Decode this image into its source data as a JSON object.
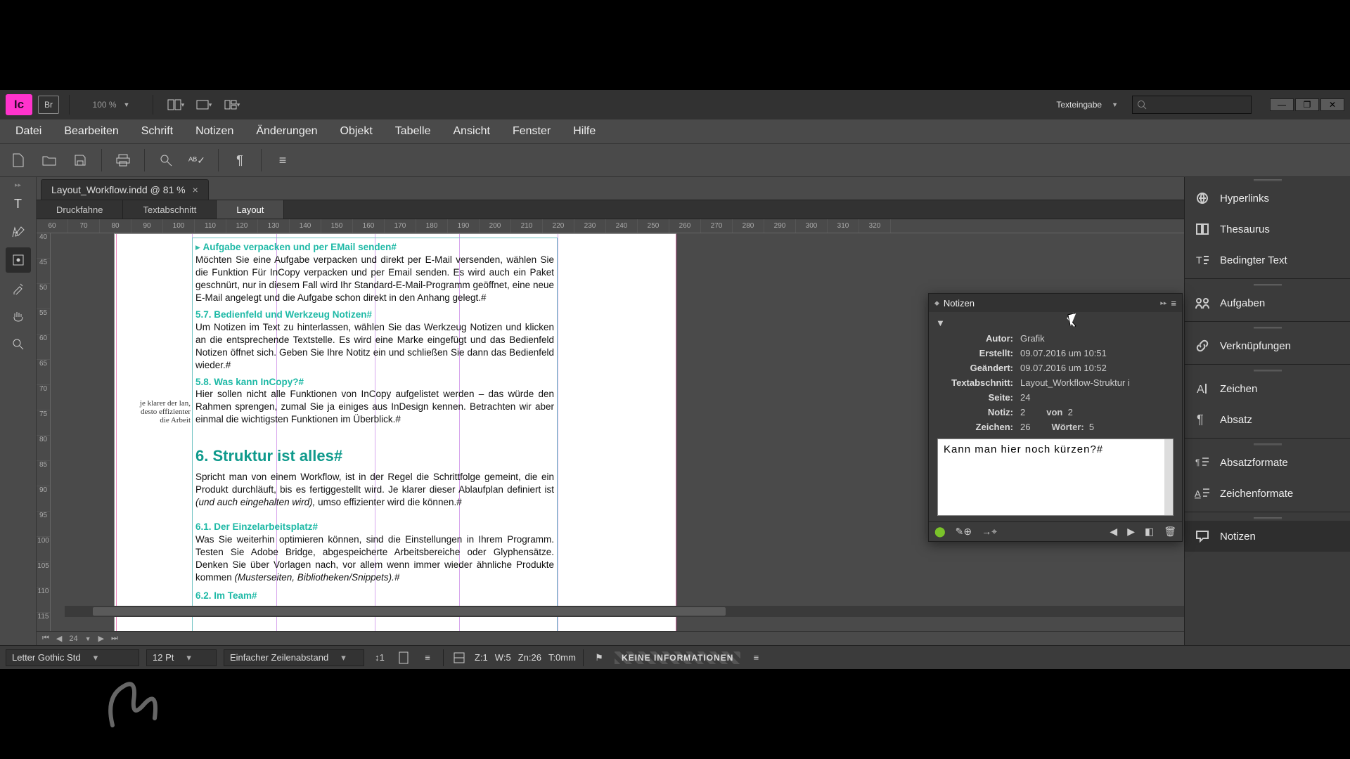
{
  "titlebar": {
    "zoom": "100 %",
    "workspace": "Texteingabe"
  },
  "menubar": [
    "Datei",
    "Bearbeiten",
    "Schrift",
    "Notizen",
    "Änderungen",
    "Objekt",
    "Tabelle",
    "Ansicht",
    "Fenster",
    "Hilfe"
  ],
  "doc": {
    "tab": "Layout_Workflow.indd @ 81 %",
    "views": [
      "Druckfahne",
      "Textabschnitt",
      "Layout"
    ],
    "active_view": 2,
    "page_nav": "24"
  },
  "ruler_h": [
    "60",
    "70",
    "80",
    "90",
    "100",
    "110",
    "120",
    "130",
    "140",
    "150",
    "160",
    "170",
    "180",
    "190",
    "200",
    "210",
    "220",
    "230",
    "240",
    "250",
    "260",
    "270",
    "280",
    "290",
    "300",
    "310",
    "320"
  ],
  "ruler_v": [
    "40",
    "45",
    "50",
    "55",
    "60",
    "65",
    "70",
    "75",
    "80",
    "85",
    "90",
    "95",
    "100",
    "105",
    "110",
    "115"
  ],
  "margin_note": "je klarer der lan,\ndesto effizienter\ndie Arbeit",
  "content": {
    "h1": "Aufgabe verpacken und per EMail senden#",
    "p1": "Möchten Sie eine Aufgabe verpacken und direkt per E-Mail versenden, wählen Sie die Funktion Für InCopy verpacken und per Email senden. Es wird auch ein Paket geschnürt, nur in diesem Fall wird Ihr Standard-E-Mail-Programm geöffnet, eine neue E-Mail angelegt und die Aufgabe schon direkt in den Anhang gelegt.#",
    "h2": "5.7.  Bedienfeld und Werkzeug Notizen#",
    "p2": "Um Notizen im Text zu hinterlassen, wählen Sie das Werkzeug Notizen und klicken an die entsprechende Textstelle. Es wird eine Marke eingefügt und das Bedienfeld Notizen öffnet sich. Geben Sie Ihre Notitz ein und schließen Sie dann das Bedienfeld wieder.#",
    "h3": "5.8.  Was kann InCopy?#",
    "p3": "Hier sollen nicht alle Funktionen von InCopy aufgelistet werden – das würde den Rahmen sprengen, zumal Sie ja einiges aus InDesign kennen. Betrachten wir aber einmal die wichtigsten Funktionen im Überblick.#",
    "h4": "6.  Struktur ist alles#",
    "p4a": "Spricht man von einem Workflow, ist in der Regel die Schrittfolge gemeint, die ein Produkt durchläuft, bis es fertiggestellt wird. Je klarer dieser Ablaufplan definiert ist ",
    "p4i": "(und auch eingehalten wird),",
    "p4b": " umso effizienter wird die können.#",
    "h5": "6.1.  Der Einzelarbeitsplatz#",
    "p5a": "Was Sie weiterhin optimieren können, sind die Einstellungen in Ihrem Programm. Testen Sie Adobe Bridge, abgespeicherte Arbeitsbereiche oder Glyphensätze. Denken Sie über Vorlagen nach, vor allem wenn immer wieder ähnliche Produkte kommen ",
    "p5i": "(Musterseiten, Bibliotheken/Snippets).#",
    "h6": "6.2.  Im Team#"
  },
  "notes": {
    "title": "Notizen",
    "author_lbl": "Autor:",
    "author": "Grafik",
    "created_lbl": "Erstellt:",
    "created": "09.07.2016 um 10:51",
    "changed_lbl": "Geändert:",
    "changed": "09.07.2016 um 10:52",
    "section_lbl": "Textabschnitt:",
    "section": "Layout_Workflow-Struktur i",
    "page_lbl": "Seite:",
    "page": "24",
    "note_lbl": "Notiz:",
    "note_idx": "2",
    "of_lbl": "von",
    "note_of": "2",
    "chars_lbl": "Zeichen:",
    "chars": "26",
    "words_lbl": "Wörter:",
    "words": "5",
    "text": "Kann man hier noch kürzen?#"
  },
  "right_panels": [
    {
      "icon": "link",
      "label": "Hyperlinks"
    },
    {
      "icon": "book",
      "label": "Thesaurus"
    },
    {
      "icon": "condtext",
      "label": "Bedingter Text"
    },
    {
      "sep": true
    },
    {
      "icon": "tasks",
      "label": "Aufgaben"
    },
    {
      "sep": true
    },
    {
      "icon": "chain",
      "label": "Verknüpfungen"
    },
    {
      "sep": true
    },
    {
      "icon": "char",
      "label": "Zeichen"
    },
    {
      "icon": "para",
      "label": "Absatz"
    },
    {
      "sep": true
    },
    {
      "icon": "pstyle",
      "label": "Absatzformate"
    },
    {
      "icon": "cstyle",
      "label": "Zeichenformate"
    },
    {
      "sep": true
    },
    {
      "icon": "notes",
      "label": "Notizen",
      "active": true
    }
  ],
  "bottom": {
    "font": "Letter Gothic Std",
    "size": "12 Pt",
    "leading": "Einfacher Zeilenabstand",
    "stats": {
      "z": "Z:1",
      "w": "W:5",
      "zn": "Zn:26",
      "t": "T:0mm"
    },
    "info": "KEINE INFORMATIONEN"
  }
}
